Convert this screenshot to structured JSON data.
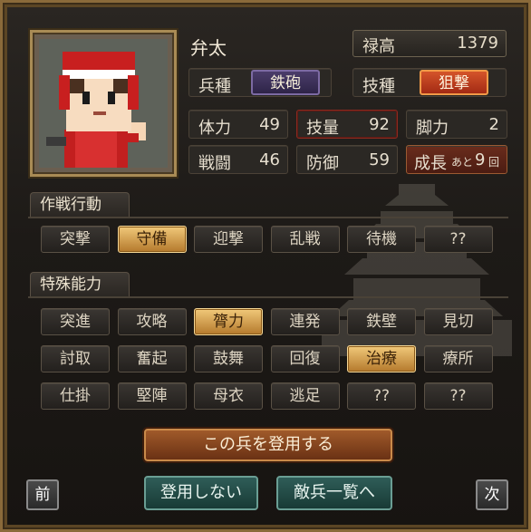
{
  "name": "弁太",
  "roku": {
    "label": "禄高",
    "value": "1379"
  },
  "heishu": {
    "label": "兵種",
    "value": "鉄砲"
  },
  "gishu": {
    "label": "技種",
    "value": "狙撃"
  },
  "stats": {
    "tairyoku": {
      "label": "体力",
      "value": "49"
    },
    "giryo": {
      "label": "技量",
      "value": "92"
    },
    "kyakuryoku": {
      "label": "脚力",
      "value": "2"
    },
    "sento": {
      "label": "戦闘",
      "value": "46"
    },
    "bogyo": {
      "label": "防御",
      "value": "59"
    },
    "seicho": {
      "label": "成長",
      "small": "あと",
      "value": "9",
      "unit": "回"
    }
  },
  "sakusen": {
    "title": "作戦行動",
    "items": [
      {
        "label": "突撃",
        "on": false
      },
      {
        "label": "守備",
        "on": true
      },
      {
        "label": "迎撃",
        "on": false
      },
      {
        "label": "乱戦",
        "on": false
      },
      {
        "label": "待機",
        "on": false
      },
      {
        "label": "??",
        "on": false
      }
    ]
  },
  "tokushu": {
    "title": "特殊能力",
    "items": [
      {
        "label": "突進",
        "on": false
      },
      {
        "label": "攻略",
        "on": false
      },
      {
        "label": "膂力",
        "on": true
      },
      {
        "label": "連発",
        "on": false
      },
      {
        "label": "鉄壁",
        "on": false
      },
      {
        "label": "見切",
        "on": false
      },
      {
        "label": "討取",
        "on": false
      },
      {
        "label": "奮起",
        "on": false
      },
      {
        "label": "鼓舞",
        "on": false
      },
      {
        "label": "回復",
        "on": false
      },
      {
        "label": "治療",
        "on": true
      },
      {
        "label": "療所",
        "on": false
      },
      {
        "label": "仕掛",
        "on": false
      },
      {
        "label": "堅陣",
        "on": false
      },
      {
        "label": "母衣",
        "on": false
      },
      {
        "label": "逃足",
        "on": false
      },
      {
        "label": "??",
        "on": false
      },
      {
        "label": "??",
        "on": false
      }
    ]
  },
  "actions": {
    "recruit": "この兵を登用する",
    "decline": "登用しない",
    "enemy_list": "敵兵一覧へ",
    "prev": "前",
    "next": "次"
  },
  "colors": {
    "accent_gold": "#f1c97a",
    "accent_red": "#d4542a",
    "panel": "#1d1a17"
  }
}
